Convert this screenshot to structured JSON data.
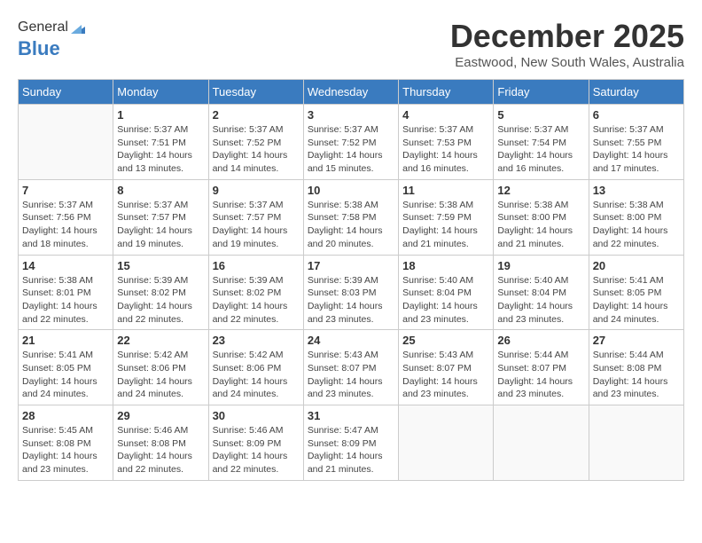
{
  "header": {
    "logo_general": "General",
    "logo_blue": "Blue",
    "month_title": "December 2025",
    "location": "Eastwood, New South Wales, Australia"
  },
  "days_of_week": [
    "Sunday",
    "Monday",
    "Tuesday",
    "Wednesday",
    "Thursday",
    "Friday",
    "Saturday"
  ],
  "weeks": [
    [
      {
        "day": "",
        "info": ""
      },
      {
        "day": "1",
        "info": "Sunrise: 5:37 AM\nSunset: 7:51 PM\nDaylight: 14 hours\nand 13 minutes."
      },
      {
        "day": "2",
        "info": "Sunrise: 5:37 AM\nSunset: 7:52 PM\nDaylight: 14 hours\nand 14 minutes."
      },
      {
        "day": "3",
        "info": "Sunrise: 5:37 AM\nSunset: 7:52 PM\nDaylight: 14 hours\nand 15 minutes."
      },
      {
        "day": "4",
        "info": "Sunrise: 5:37 AM\nSunset: 7:53 PM\nDaylight: 14 hours\nand 16 minutes."
      },
      {
        "day": "5",
        "info": "Sunrise: 5:37 AM\nSunset: 7:54 PM\nDaylight: 14 hours\nand 16 minutes."
      },
      {
        "day": "6",
        "info": "Sunrise: 5:37 AM\nSunset: 7:55 PM\nDaylight: 14 hours\nand 17 minutes."
      }
    ],
    [
      {
        "day": "7",
        "info": "Sunrise: 5:37 AM\nSunset: 7:56 PM\nDaylight: 14 hours\nand 18 minutes."
      },
      {
        "day": "8",
        "info": "Sunrise: 5:37 AM\nSunset: 7:57 PM\nDaylight: 14 hours\nand 19 minutes."
      },
      {
        "day": "9",
        "info": "Sunrise: 5:37 AM\nSunset: 7:57 PM\nDaylight: 14 hours\nand 19 minutes."
      },
      {
        "day": "10",
        "info": "Sunrise: 5:38 AM\nSunset: 7:58 PM\nDaylight: 14 hours\nand 20 minutes."
      },
      {
        "day": "11",
        "info": "Sunrise: 5:38 AM\nSunset: 7:59 PM\nDaylight: 14 hours\nand 21 minutes."
      },
      {
        "day": "12",
        "info": "Sunrise: 5:38 AM\nSunset: 8:00 PM\nDaylight: 14 hours\nand 21 minutes."
      },
      {
        "day": "13",
        "info": "Sunrise: 5:38 AM\nSunset: 8:00 PM\nDaylight: 14 hours\nand 22 minutes."
      }
    ],
    [
      {
        "day": "14",
        "info": "Sunrise: 5:38 AM\nSunset: 8:01 PM\nDaylight: 14 hours\nand 22 minutes."
      },
      {
        "day": "15",
        "info": "Sunrise: 5:39 AM\nSunset: 8:02 PM\nDaylight: 14 hours\nand 22 minutes."
      },
      {
        "day": "16",
        "info": "Sunrise: 5:39 AM\nSunset: 8:02 PM\nDaylight: 14 hours\nand 22 minutes."
      },
      {
        "day": "17",
        "info": "Sunrise: 5:39 AM\nSunset: 8:03 PM\nDaylight: 14 hours\nand 23 minutes."
      },
      {
        "day": "18",
        "info": "Sunrise: 5:40 AM\nSunset: 8:04 PM\nDaylight: 14 hours\nand 23 minutes."
      },
      {
        "day": "19",
        "info": "Sunrise: 5:40 AM\nSunset: 8:04 PM\nDaylight: 14 hours\nand 23 minutes."
      },
      {
        "day": "20",
        "info": "Sunrise: 5:41 AM\nSunset: 8:05 PM\nDaylight: 14 hours\nand 24 minutes."
      }
    ],
    [
      {
        "day": "21",
        "info": "Sunrise: 5:41 AM\nSunset: 8:05 PM\nDaylight: 14 hours\nand 24 minutes."
      },
      {
        "day": "22",
        "info": "Sunrise: 5:42 AM\nSunset: 8:06 PM\nDaylight: 14 hours\nand 24 minutes."
      },
      {
        "day": "23",
        "info": "Sunrise: 5:42 AM\nSunset: 8:06 PM\nDaylight: 14 hours\nand 24 minutes."
      },
      {
        "day": "24",
        "info": "Sunrise: 5:43 AM\nSunset: 8:07 PM\nDaylight: 14 hours\nand 23 minutes."
      },
      {
        "day": "25",
        "info": "Sunrise: 5:43 AM\nSunset: 8:07 PM\nDaylight: 14 hours\nand 23 minutes."
      },
      {
        "day": "26",
        "info": "Sunrise: 5:44 AM\nSunset: 8:07 PM\nDaylight: 14 hours\nand 23 minutes."
      },
      {
        "day": "27",
        "info": "Sunrise: 5:44 AM\nSunset: 8:08 PM\nDaylight: 14 hours\nand 23 minutes."
      }
    ],
    [
      {
        "day": "28",
        "info": "Sunrise: 5:45 AM\nSunset: 8:08 PM\nDaylight: 14 hours\nand 23 minutes."
      },
      {
        "day": "29",
        "info": "Sunrise: 5:46 AM\nSunset: 8:08 PM\nDaylight: 14 hours\nand 22 minutes."
      },
      {
        "day": "30",
        "info": "Sunrise: 5:46 AM\nSunset: 8:09 PM\nDaylight: 14 hours\nand 22 minutes."
      },
      {
        "day": "31",
        "info": "Sunrise: 5:47 AM\nSunset: 8:09 PM\nDaylight: 14 hours\nand 21 minutes."
      },
      {
        "day": "",
        "info": ""
      },
      {
        "day": "",
        "info": ""
      },
      {
        "day": "",
        "info": ""
      }
    ]
  ]
}
